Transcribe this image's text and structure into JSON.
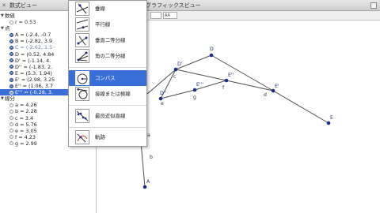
{
  "algebra_panel": {
    "title": "数式ビュー",
    "categories": [
      {
        "label": "数値",
        "items": [
          {
            "text": "r = 0.53",
            "kind": "num"
          }
        ]
      },
      {
        "label": "点",
        "items": [
          {
            "text": "A = (-2.4, -0.7",
            "kind": "pt"
          },
          {
            "text": "B = (-2.82, 3.9",
            "kind": "pt"
          },
          {
            "text": "C = (-2.62, 1.5",
            "kind": "pt",
            "dim": true
          },
          {
            "text": "D = (0.52, 4.84",
            "kind": "pt"
          },
          {
            "text": "D' = (-1.14, 4.",
            "kind": "pt"
          },
          {
            "text": "D'' = (-1.83, 2.",
            "kind": "pt"
          },
          {
            "text": "E = (5.3, 1.94)",
            "kind": "pt"
          },
          {
            "text": "E' = (2.98, 3.25",
            "kind": "pt"
          },
          {
            "text": "E'' = (1.06, 3.7",
            "kind": "pt"
          },
          {
            "text": "E''' = (-0.28, 3.",
            "kind": "pt",
            "selected": true
          }
        ]
      },
      {
        "label": "線分",
        "items": [
          {
            "text": "a = 4.26",
            "kind": "seg"
          },
          {
            "text": "b = 2.28",
            "kind": "seg"
          },
          {
            "text": "c = 3.4",
            "kind": "seg"
          },
          {
            "text": "d = 5.76",
            "kind": "seg"
          },
          {
            "text": "e = 3.05",
            "kind": "seg"
          },
          {
            "text": "f = 4.23",
            "kind": "seg"
          },
          {
            "text": "g = 2.99",
            "kind": "seg"
          }
        ]
      }
    ]
  },
  "graphics_panel": {
    "title": "グラフィックスビュー",
    "style_boxes": [
      "",
      "AA"
    ]
  },
  "tool_menu": {
    "items": [
      {
        "name": "perpendicular-line-tool",
        "label": "垂線"
      },
      {
        "name": "parallel-line-tool",
        "label": "平行線"
      },
      {
        "name": "perpendicular-bisector-tool",
        "label": "垂直二等分線"
      },
      {
        "name": "angle-bisector-tool",
        "label": "角の二等分線"
      },
      {
        "name": "compass-tool",
        "label": "コンパス",
        "active": true
      },
      {
        "name": "tangent-line-tool",
        "label": "接線または極線"
      },
      {
        "name": "best-fit-line-tool",
        "label": "最良近似直線"
      },
      {
        "name": "locus-tool",
        "label": "軌跡"
      }
    ]
  },
  "points": [
    {
      "label": "D'"
    },
    {
      "label": "D"
    },
    {
      "label": "E''"
    },
    {
      "label": "E'"
    },
    {
      "label": "D''"
    },
    {
      "label": "E'''"
    },
    {
      "label": "E"
    },
    {
      "label": "A"
    }
  ],
  "segments": [
    {
      "label": "c"
    },
    {
      "label": "f"
    },
    {
      "label": "d"
    },
    {
      "label": "e"
    },
    {
      "label": "g"
    },
    {
      "label": "a"
    },
    {
      "label": "b"
    }
  ],
  "colors": {
    "selection": "#3a6fd8",
    "point_fill": "#1f2d86",
    "line": "#4d4d4d"
  }
}
